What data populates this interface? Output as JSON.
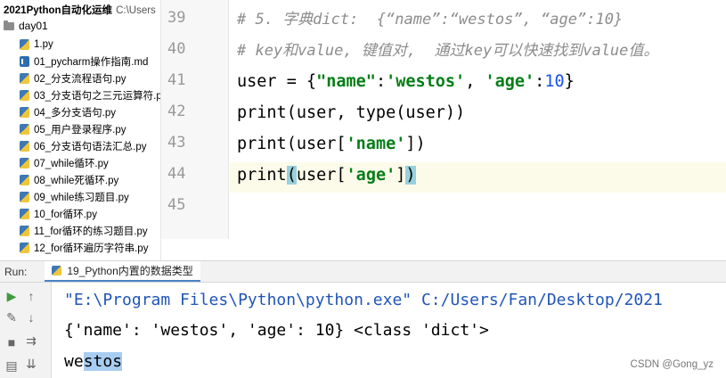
{
  "project": {
    "title": "2021Python自动化运维",
    "path": "C:\\Users",
    "folder": "day01",
    "files": [
      {
        "name": "1.py",
        "type": "py"
      },
      {
        "name": "01_pycharm操作指南.md",
        "type": "md"
      },
      {
        "name": "02_分支流程语句.py",
        "type": "py"
      },
      {
        "name": "03_分支语句之三元运算符.p",
        "type": "py"
      },
      {
        "name": "04_多分支语句.py",
        "type": "py"
      },
      {
        "name": "05_用户登录程序.py",
        "type": "py"
      },
      {
        "name": "06_分支语句语法汇总.py",
        "type": "py"
      },
      {
        "name": "07_while循环.py",
        "type": "py"
      },
      {
        "name": "08_while死循环.py",
        "type": "py"
      },
      {
        "name": "09_while练习题目.py",
        "type": "py"
      },
      {
        "name": "10_for循环.py",
        "type": "py"
      },
      {
        "name": "11_for循环的练习题目.py",
        "type": "py"
      },
      {
        "name": "12_for循环遍历字符串.py",
        "type": "py"
      }
    ]
  },
  "editor": {
    "line_numbers": [
      "39",
      "40",
      "41",
      "42",
      "43",
      "44",
      "45"
    ],
    "code": {
      "l39": "# 5. 字典dict:  {“name”:“westos”, “age”:10}",
      "l40": "# key和value, 键值对,  通过key可以快速找到value值。",
      "l41_a": "user = {",
      "l41_b": "\"name\"",
      "l41_c": ":",
      "l41_d": "'westos'",
      "l41_e": ", ",
      "l41_f": "'age'",
      "l41_g": ":",
      "l41_h": "10",
      "l41_i": "}",
      "l42": "print(user, type(user))",
      "l43_a": "print(user[",
      "l43_b": "'name'",
      "l43_c": "])",
      "l44_a": "print",
      "l44_b": "(",
      "l44_c": "user[",
      "l44_d": "'age'",
      "l44_e": "]",
      "l44_f": ")"
    }
  },
  "run": {
    "label": "Run:",
    "tab": "19_Python内置的数据类型",
    "output": [
      "\"E:\\Program Files\\Python\\python.exe\" C:/Users/Fan/Desktop/2021",
      "{'name': 'westos', 'age': 10} <class 'dict'>"
    ],
    "output_line3_a": "we",
    "output_line3_b": "stos"
  },
  "watermark": "CSDN @Gong_yz"
}
